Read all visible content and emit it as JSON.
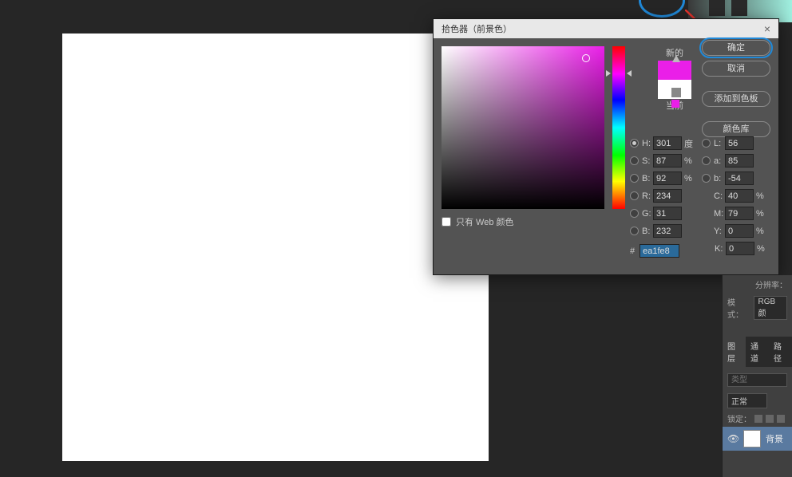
{
  "dialog": {
    "title": "拾色器（前景色）",
    "close": "×",
    "new_label": "新的",
    "current_label": "当前",
    "ok": "确定",
    "cancel": "取消",
    "add_swatch": "添加到色板",
    "libraries": "颜色库",
    "web_only": "只有 Web 颜色",
    "new_color": "#ea1fe8",
    "current_color": "#ffffff",
    "fields": {
      "h": {
        "label": "H:",
        "value": "301",
        "unit": "度"
      },
      "s": {
        "label": "S:",
        "value": "87",
        "unit": "%"
      },
      "br": {
        "label": "B:",
        "value": "92",
        "unit": "%"
      },
      "r": {
        "label": "R:",
        "value": "234"
      },
      "g": {
        "label": "G:",
        "value": "31"
      },
      "b": {
        "label": "B:",
        "value": "232"
      },
      "l": {
        "label": "L:",
        "value": "56"
      },
      "a": {
        "label": "a:",
        "value": "85"
      },
      "lab_b": {
        "label": "b:",
        "value": "-54"
      },
      "c": {
        "label": "C:",
        "value": "40",
        "unit": "%"
      },
      "m": {
        "label": "M:",
        "value": "79",
        "unit": "%"
      },
      "y": {
        "label": "Y:",
        "value": "0",
        "unit": "%"
      },
      "k": {
        "label": "K:",
        "value": "0",
        "unit": "%"
      },
      "hex": {
        "label": "#",
        "value": "ea1fe8"
      }
    }
  },
  "panels": {
    "resolution_label": "分辨率：",
    "mode_label": "模式：",
    "mode_value": "RGB 颜",
    "tabs": {
      "layers": "图层",
      "channels": "通道",
      "paths": "路径"
    },
    "search_placeholder": "类型",
    "search_icon": "🔍",
    "blend_mode": "正常",
    "lock_label": "锁定：",
    "bg_layer": "背景"
  }
}
